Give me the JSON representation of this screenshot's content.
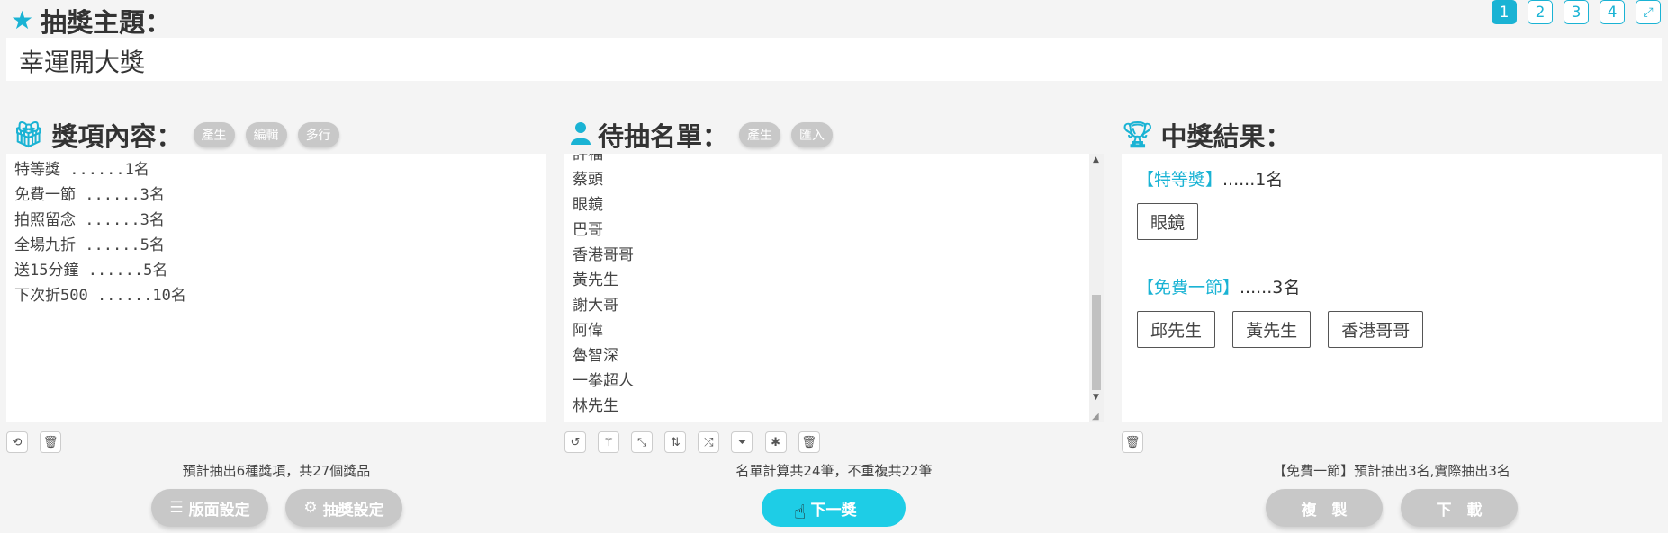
{
  "theme": {
    "label": "抽獎主題：",
    "title_value": "幸運開大獎"
  },
  "pages": [
    "1",
    "2",
    "3",
    "4"
  ],
  "prizes": {
    "heading": "獎項內容：",
    "buttons": [
      "產生",
      "編輯",
      "多行"
    ],
    "items": [
      "特等獎 ......1名",
      "免費一節 ......3名",
      "拍照留念 ......3名",
      "全場九折 ......5名",
      "送15分鐘 ......5名",
      "下次折500 ......10名"
    ],
    "summary": "預計抽出6種獎項，共27個獎品"
  },
  "names": {
    "heading": "待抽名單：",
    "buttons": [
      "產生",
      "匯入"
    ],
    "items": [
      "許福",
      "蔡頭",
      "眼鏡",
      "巴哥",
      "香港哥哥",
      "黃先生",
      "謝大哥",
      "阿偉",
      "魯智深",
      "一拳超人",
      "林先生"
    ],
    "summary": "名單計算共24筆，不重複共22筆"
  },
  "results": {
    "heading": "中獎結果：",
    "groups": [
      {
        "name": "【特等獎】",
        "count": "......1名",
        "winners": [
          "眼鏡"
        ]
      },
      {
        "name": "【免費一節】",
        "count": "......3名",
        "winners": [
          "邱先生",
          "黃先生",
          "香港哥哥"
        ]
      }
    ],
    "summary": "【免費一節】預計抽出3名,實際抽出3名"
  },
  "actions": {
    "layout_settings": "版面設定",
    "draw_settings": "抽獎設定",
    "next_prize": "下一獎",
    "copy": "複　製",
    "download": "下　載"
  },
  "colors": {
    "accent": "#1ab3d4",
    "button_cyan": "#1ecde6",
    "pill_grey": "#c8c8c8"
  }
}
